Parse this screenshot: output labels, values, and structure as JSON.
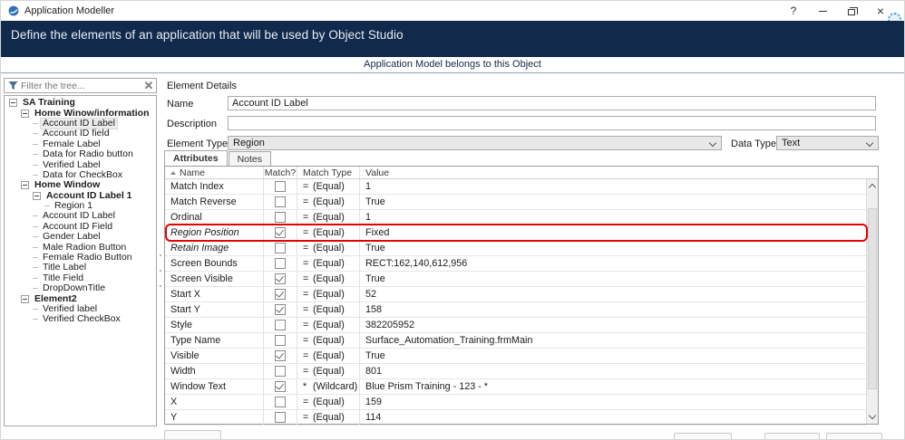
{
  "window": {
    "title": "Application Modeller",
    "controls": {
      "help": "?",
      "close": "×"
    }
  },
  "header": {
    "subtitle": "Define the elements of an application that will be used by Object Studio",
    "banner": "Application Model belongs to this Object"
  },
  "tree": {
    "filter_placeholder": "Filter the tree...",
    "nodes": [
      {
        "label": "SA Training",
        "level": 0,
        "bold": true,
        "expander": true
      },
      {
        "label": "Home Winow/information",
        "level": 1,
        "bold": true,
        "expander": true
      },
      {
        "label": "Account ID Label",
        "level": 2,
        "selected": true
      },
      {
        "label": "Account ID field",
        "level": 2
      },
      {
        "label": "Female Label",
        "level": 2
      },
      {
        "label": "Data for Radio button",
        "level": 2
      },
      {
        "label": "Verified Label",
        "level": 2
      },
      {
        "label": "Data for CheckBox",
        "level": 2
      },
      {
        "label": "Home Window",
        "level": 1,
        "bold": true,
        "expander": true
      },
      {
        "label": "Account ID Label 1",
        "level": 2,
        "bold": true,
        "expander": true
      },
      {
        "label": "Region 1",
        "level": 3
      },
      {
        "label": "Account ID Label",
        "level": 2
      },
      {
        "label": "Account ID Field",
        "level": 2
      },
      {
        "label": "Gender Label",
        "level": 2
      },
      {
        "label": "Male Radion Button",
        "level": 2
      },
      {
        "label": "Female Radio Button",
        "level": 2
      },
      {
        "label": "Title Label",
        "level": 2
      },
      {
        "label": "Title Field",
        "level": 2
      },
      {
        "label": "DropDownTitle",
        "level": 2
      },
      {
        "label": "Element2",
        "level": 1,
        "bold": true,
        "expander": true
      },
      {
        "label": "Verified label",
        "level": 2
      },
      {
        "label": "Verified CheckBox",
        "level": 2
      }
    ]
  },
  "details": {
    "section_title": "Element Details",
    "name_label": "Name",
    "name_value": "Account ID Label",
    "description_label": "Description",
    "description_value": "",
    "element_type_label": "Element Type",
    "element_type_value": "Region",
    "data_type_label": "Data Type",
    "data_type_value": "Text",
    "tabs": [
      {
        "label": "Attributes",
        "active": true
      },
      {
        "label": "Notes",
        "active": false
      }
    ]
  },
  "attributes_table": {
    "columns": [
      "Name",
      "Match?",
      "Match Type",
      "Value"
    ],
    "rows": [
      {
        "name": "Match Index",
        "match": false,
        "op": "=",
        "type": "(Equal)",
        "value": "1"
      },
      {
        "name": "Match Reverse",
        "match": false,
        "op": "=",
        "type": "(Equal)",
        "value": "True"
      },
      {
        "name": "Ordinal",
        "match": false,
        "op": "=",
        "type": "(Equal)",
        "value": "1"
      },
      {
        "name": "Region Position",
        "match": true,
        "op": "=",
        "type": "(Equal)",
        "value": "Fixed",
        "italic": true,
        "highlighted": true
      },
      {
        "name": "Retain Image",
        "match": false,
        "op": "=",
        "type": "(Equal)",
        "value": "True",
        "italic": true
      },
      {
        "name": "Screen Bounds",
        "match": false,
        "op": "=",
        "type": "(Equal)",
        "value": "RECT:162,140,612,956"
      },
      {
        "name": "Screen Visible",
        "match": true,
        "op": "=",
        "type": "(Equal)",
        "value": "True"
      },
      {
        "name": "Start X",
        "match": true,
        "op": "=",
        "type": "(Equal)",
        "value": "52"
      },
      {
        "name": "Start Y",
        "match": true,
        "op": "=",
        "type": "(Equal)",
        "value": "158"
      },
      {
        "name": "Style",
        "match": false,
        "op": "=",
        "type": "(Equal)",
        "value": "382205952"
      },
      {
        "name": "Type Name",
        "match": false,
        "op": "=",
        "type": "(Equal)",
        "value": "Surface_Automation_Training.frmMain"
      },
      {
        "name": "Visible",
        "match": true,
        "op": "=",
        "type": "(Equal)",
        "value": "True"
      },
      {
        "name": "Width",
        "match": false,
        "op": "=",
        "type": "(Equal)",
        "value": "801"
      },
      {
        "name": "Window Text",
        "match": true,
        "op": "*",
        "type": "(Wildcard)",
        "value": "Blue Prism Training - 123 - *"
      },
      {
        "name": "X",
        "match": false,
        "op": "=",
        "type": "(Equal)",
        "value": "159"
      },
      {
        "name": "Y",
        "match": false,
        "op": "=",
        "type": "(Equal)",
        "value": "114"
      }
    ]
  },
  "colors": {
    "header_bg": "#11294b",
    "highlight_red": "#e60000"
  }
}
